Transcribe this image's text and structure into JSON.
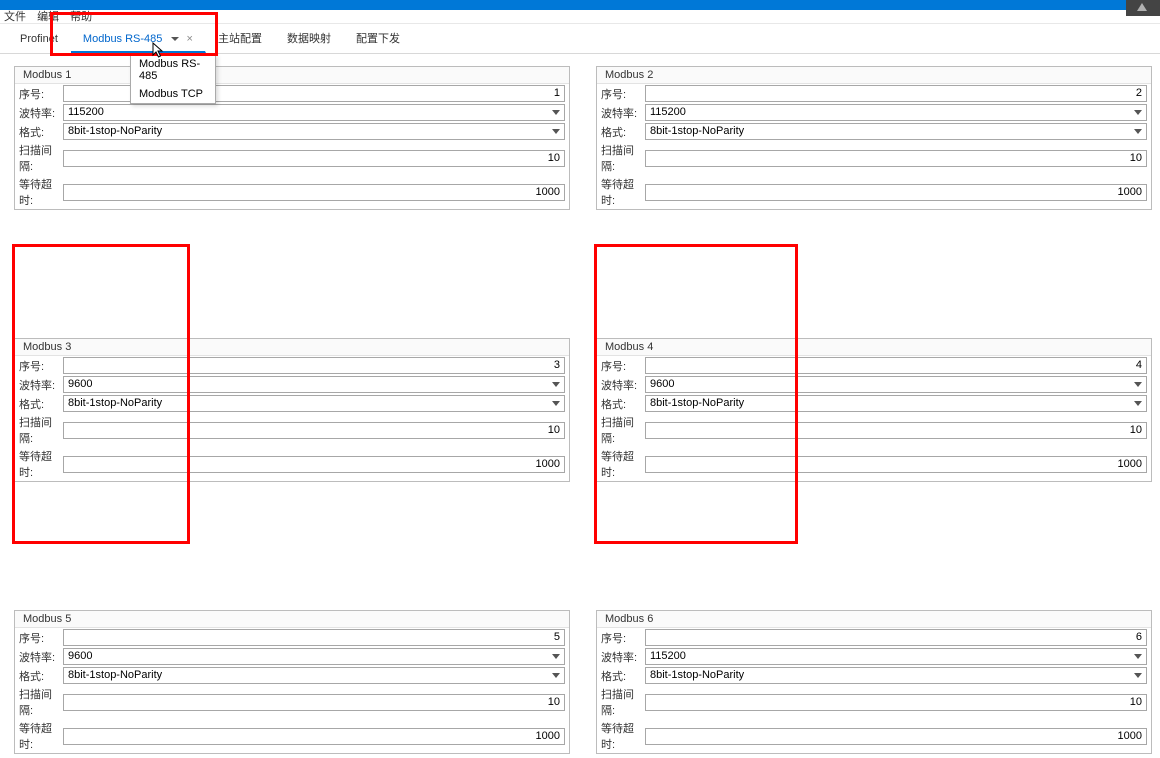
{
  "menu": {
    "file": "文件",
    "edit": "编辑",
    "help": "帮助"
  },
  "tabs": {
    "profinet": "Profinet",
    "modbus485": "Modbus RS-485",
    "t3": "主站配置",
    "t4": "数据映射",
    "t5": "配置下发"
  },
  "dropdown": {
    "i1": "Modbus RS-485",
    "i2": "Modbus TCP"
  },
  "labels": {
    "index": "序号:",
    "baud": "波特率:",
    "format": "格式:",
    "scan": "扫描间隔:",
    "wait": "等待超时:"
  },
  "fmt": "8bit-1stop-NoParity",
  "p1": {
    "title": "Modbus 1",
    "index": "1",
    "baud": "115200",
    "scan": "10",
    "wait": "1000"
  },
  "p2": {
    "title": "Modbus 2",
    "index": "2",
    "baud": "115200",
    "scan": "10",
    "wait": "1000"
  },
  "p3": {
    "title": "Modbus 3",
    "index": "3",
    "baud": "9600",
    "scan": "10",
    "wait": "1000"
  },
  "p4": {
    "title": "Modbus 4",
    "index": "4",
    "baud": "9600",
    "scan": "10",
    "wait": "1000"
  },
  "p5": {
    "title": "Modbus 5",
    "index": "5",
    "baud": "9600",
    "scan": "10",
    "wait": "1000"
  },
  "p6": {
    "title": "Modbus 6",
    "index": "6",
    "baud": "115200",
    "scan": "10",
    "wait": "1000"
  }
}
